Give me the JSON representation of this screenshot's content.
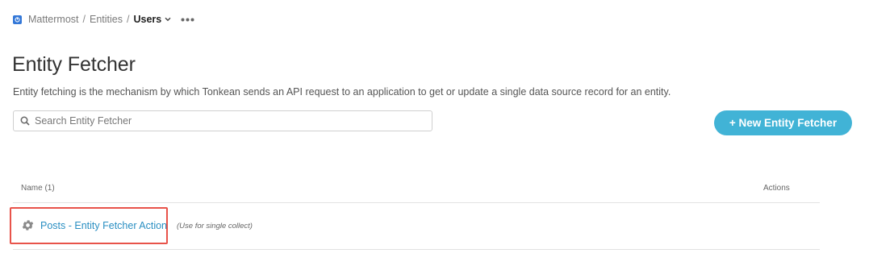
{
  "breadcrumb": {
    "items": [
      "Mattermost",
      "Entities"
    ],
    "separator": "/",
    "current": "Users",
    "logo_icon": "mattermost-logo-icon",
    "more_icon": "more-horizontal-icon"
  },
  "page": {
    "title": "Entity Fetcher",
    "description": "Entity fetching is the mechanism by which Tonkean sends an API request to an application to get or update a single data source record for an entity."
  },
  "search": {
    "placeholder": "Search Entity Fetcher",
    "value": ""
  },
  "toolbar": {
    "new_button_label": "+ New Entity Fetcher"
  },
  "table": {
    "columns": {
      "name": "Name (1)",
      "actions": "Actions"
    },
    "rows": [
      {
        "icon": "gear-icon",
        "name": "Posts - Entity Fetcher Action",
        "note": "(Use for single collect)"
      }
    ]
  },
  "colors": {
    "accent": "#41b3d6",
    "link": "#2a8fc2",
    "highlight": "#e8534a",
    "logo": "#3478d8"
  }
}
